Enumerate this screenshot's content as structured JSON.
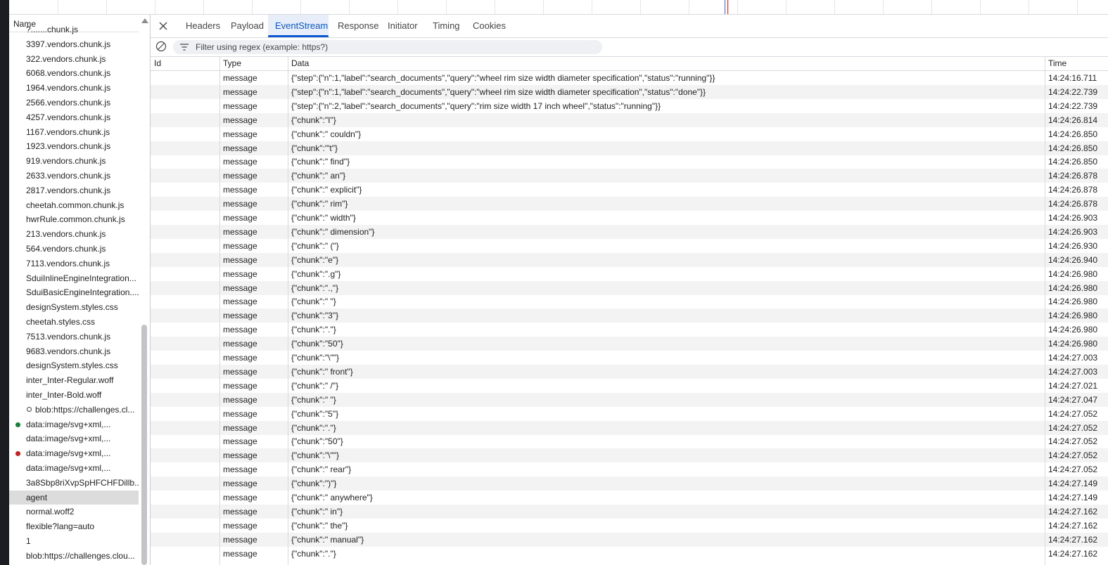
{
  "colors": {
    "accent": "#0b57d0",
    "selected_row": "#dcdcdc",
    "marker_blue": "#4a66d8",
    "marker_red": "#d93025"
  },
  "request_list": {
    "header": "Name",
    "items": [
      {
        "label": "?.......chunk.js"
      },
      {
        "label": "3397.vendors.chunk.js"
      },
      {
        "label": "322.vendors.chunk.js"
      },
      {
        "label": "6068.vendors.chunk.js"
      },
      {
        "label": "1964.vendors.chunk.js"
      },
      {
        "label": "2566.vendors.chunk.js"
      },
      {
        "label": "4257.vendors.chunk.js"
      },
      {
        "label": "1167.vendors.chunk.js"
      },
      {
        "label": "1923.vendors.chunk.js"
      },
      {
        "label": "919.vendors.chunk.js"
      },
      {
        "label": "2633.vendors.chunk.js"
      },
      {
        "label": "2817.vendors.chunk.js"
      },
      {
        "label": "cheetah.common.chunk.js"
      },
      {
        "label": "hwrRule.common.chunk.js"
      },
      {
        "label": "213.vendors.chunk.js"
      },
      {
        "label": "564.vendors.chunk.js"
      },
      {
        "label": "7113.vendors.chunk.js"
      },
      {
        "label": "SduiInlineEngineIntegration..."
      },
      {
        "label": "SduiBasicEngineIntegration...."
      },
      {
        "label": "designSystem.styles.css"
      },
      {
        "label": "cheetah.styles.css"
      },
      {
        "label": "7513.vendors.chunk.js"
      },
      {
        "label": "9683.vendors.chunk.js"
      },
      {
        "label": "designSystem.styles.css"
      },
      {
        "label": "inter_Inter-Regular.woff"
      },
      {
        "label": "inter_Inter-Bold.woff"
      },
      {
        "label": "blob:https://challenges.cl...",
        "icon": "ring"
      },
      {
        "label": "data:image/svg+xml,...",
        "icon": "green-dot"
      },
      {
        "label": "data:image/svg+xml,..."
      },
      {
        "label": "data:image/svg+xml,...",
        "icon": "red-dot"
      },
      {
        "label": "data:image/svg+xml,..."
      },
      {
        "label": "3a8Sbp8riXvpSpHFCHFDillb..."
      },
      {
        "label": "agent",
        "selected": true
      },
      {
        "label": "normal.woff2"
      },
      {
        "label": "flexible?lang=auto"
      },
      {
        "label": "1"
      },
      {
        "label": "blob:https://challenges.clou..."
      }
    ]
  },
  "tabs": [
    "Headers",
    "Payload",
    "EventStream",
    "Response",
    "Initiator",
    "Timing",
    "Cookies"
  ],
  "active_tab": "EventStream",
  "filter": {
    "placeholder": "Filter using regex (example: https?)"
  },
  "table": {
    "columns": [
      "Id",
      "Type",
      "Data",
      "Time"
    ],
    "rows": [
      {
        "type": "message",
        "data": "{\"step\":{\"n\":1,\"label\":\"search_documents\",\"query\":\"wheel rim size width diameter specification\",\"status\":\"running\"}}",
        "time": "14:24:16.711"
      },
      {
        "type": "message",
        "data": "{\"step\":{\"n\":1,\"label\":\"search_documents\",\"query\":\"wheel rim size width diameter specification\",\"status\":\"done\"}}",
        "time": "14:24:22.739"
      },
      {
        "type": "message",
        "data": "{\"step\":{\"n\":2,\"label\":\"search_documents\",\"query\":\"rim size width 17 inch wheel\",\"status\":\"running\"}}",
        "time": "14:24:22.739"
      },
      {
        "type": "message",
        "data": "{\"chunk\":\"I\"}",
        "time": "14:24:26.814"
      },
      {
        "type": "message",
        "data": "{\"chunk\":\" couldn\"}",
        "time": "14:24:26.850"
      },
      {
        "type": "message",
        "data": "{\"chunk\":\"'t\"}",
        "time": "14:24:26.850"
      },
      {
        "type": "message",
        "data": "{\"chunk\":\" find\"}",
        "time": "14:24:26.850"
      },
      {
        "type": "message",
        "data": "{\"chunk\":\" an\"}",
        "time": "14:24:26.878"
      },
      {
        "type": "message",
        "data": "{\"chunk\":\" explicit\"}",
        "time": "14:24:26.878"
      },
      {
        "type": "message",
        "data": "{\"chunk\":\" rim\"}",
        "time": "14:24:26.878"
      },
      {
        "type": "message",
        "data": "{\"chunk\":\" width\"}",
        "time": "14:24:26.903"
      },
      {
        "type": "message",
        "data": "{\"chunk\":\" dimension\"}",
        "time": "14:24:26.903"
      },
      {
        "type": "message",
        "data": "{\"chunk\":\" (\"}",
        "time": "14:24:26.930"
      },
      {
        "type": "message",
        "data": "{\"chunk\":\"e\"}",
        "time": "14:24:26.940"
      },
      {
        "type": "message",
        "data": "{\"chunk\":\".g\"}",
        "time": "14:24:26.980"
      },
      {
        "type": "message",
        "data": "{\"chunk\":\".,\"}",
        "time": "14:24:26.980"
      },
      {
        "type": "message",
        "data": "{\"chunk\":\" \"}",
        "time": "14:24:26.980"
      },
      {
        "type": "message",
        "data": "{\"chunk\":\"3\"}",
        "time": "14:24:26.980"
      },
      {
        "type": "message",
        "data": "{\"chunk\":\".\"}",
        "time": "14:24:26.980"
      },
      {
        "type": "message",
        "data": "{\"chunk\":\"50\"}",
        "time": "14:24:26.980"
      },
      {
        "type": "message",
        "data": "{\"chunk\":\"\\\"\"}",
        "time": "14:24:27.003"
      },
      {
        "type": "message",
        "data": "{\"chunk\":\" front\"}",
        "time": "14:24:27.003"
      },
      {
        "type": "message",
        "data": "{\"chunk\":\" /\"}",
        "time": "14:24:27.021"
      },
      {
        "type": "message",
        "data": "{\"chunk\":\" \"}",
        "time": "14:24:27.047"
      },
      {
        "type": "message",
        "data": "{\"chunk\":\"5\"}",
        "time": "14:24:27.052"
      },
      {
        "type": "message",
        "data": "{\"chunk\":\".\"}",
        "time": "14:24:27.052"
      },
      {
        "type": "message",
        "data": "{\"chunk\":\"50\"}",
        "time": "14:24:27.052"
      },
      {
        "type": "message",
        "data": "{\"chunk\":\"\\\"\"}",
        "time": "14:24:27.052"
      },
      {
        "type": "message",
        "data": "{\"chunk\":\" rear\"}",
        "time": "14:24:27.052"
      },
      {
        "type": "message",
        "data": "{\"chunk\":\")\"}",
        "time": "14:24:27.149"
      },
      {
        "type": "message",
        "data": "{\"chunk\":\" anywhere\"}",
        "time": "14:24:27.149"
      },
      {
        "type": "message",
        "data": "{\"chunk\":\" in\"}",
        "time": "14:24:27.162"
      },
      {
        "type": "message",
        "data": "{\"chunk\":\" the\"}",
        "time": "14:24:27.162"
      },
      {
        "type": "message",
        "data": "{\"chunk\":\" manual\"}",
        "time": "14:24:27.162"
      },
      {
        "type": "message",
        "data": "{\"chunk\":\".\"}",
        "time": "14:24:27.162"
      }
    ]
  }
}
